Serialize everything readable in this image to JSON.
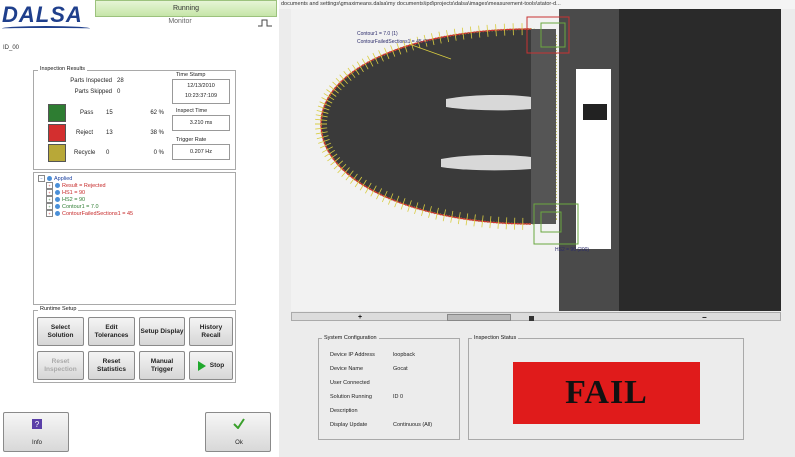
{
  "header": {
    "logo_text": "DALSA",
    "status": "Running",
    "monitor": "Monitor",
    "id": "ID_00"
  },
  "inspection_results": {
    "title": "Inspection Results",
    "parts_inspected_label": "Parts Inspected",
    "parts_inspected": "28",
    "parts_skipped_label": "Parts Skipped",
    "parts_skipped": "0",
    "rows": [
      {
        "label": "Pass",
        "count": "15",
        "pct": "62 %",
        "color": "#2e7d32"
      },
      {
        "label": "Reject",
        "count": "13",
        "pct": "38 %",
        "color": "#d32f2f"
      },
      {
        "label": "Recycle",
        "count": "0",
        "pct": "0 %",
        "color": "#b8a838"
      }
    ],
    "time_stamp_label": "Time Stamp",
    "time_stamp_date": "12/13/2010",
    "time_stamp_time": "10:23:37:109",
    "inspect_time_label": "Inspect Time",
    "inspect_time": "3.210 ms",
    "trigger_rate_label": "Trigger Rate",
    "trigger_rate": "0.207 Hz"
  },
  "tree": {
    "items": [
      {
        "text": "Applied",
        "color": "blue"
      },
      {
        "text": "Result = Rejected",
        "color": "red"
      },
      {
        "text": "HS1 = 90",
        "color": "red"
      },
      {
        "text": "HS2 = 90",
        "color": "green"
      },
      {
        "text": "Contour1 = 7.0",
        "color": "green"
      },
      {
        "text": "ContourFailedSections1 = 45",
        "color": "red"
      }
    ]
  },
  "runtime_setup": {
    "title": "Runtime Setup",
    "buttons": {
      "select_solution": "Select Solution",
      "edit_tolerances": "Edit Tolerances",
      "setup_display": "Setup Display",
      "history_recall": "History Recall",
      "reset_inspection": "Reset Inspection",
      "reset_statistics": "Reset Statistics",
      "manual_trigger": "Manual Trigger",
      "stop": "Stop"
    }
  },
  "bottom_buttons": {
    "info": "Info",
    "ok": "Ok"
  },
  "image_view": {
    "path": "documents and settings\\gmaximeans.dalsa\\my documents\\ipd\\projects\\dalsa\\images\\measurement-tools\\stator-d...",
    "contour_label_1": "Contour1 = 7.0 (1)",
    "contour_label_2": "ContourFailedSections1 = 45 (1)",
    "hs2_label": "HS2 = 90 (200)"
  },
  "system_configuration": {
    "title": "System Configuration",
    "rows": [
      {
        "label": "Device IP Address",
        "value": "loopback"
      },
      {
        "label": "Device Name",
        "value": "Gocat"
      },
      {
        "label": "User Connected",
        "value": ""
      },
      {
        "label": "Solution Running",
        "value": "ID 0"
      },
      {
        "label": "Description",
        "value": ""
      },
      {
        "label": "Display Update",
        "value": "Continuous (All)"
      }
    ]
  },
  "inspection_status": {
    "title": "Inspection Status",
    "result": "FAIL",
    "result_color": "#e01b1b"
  }
}
